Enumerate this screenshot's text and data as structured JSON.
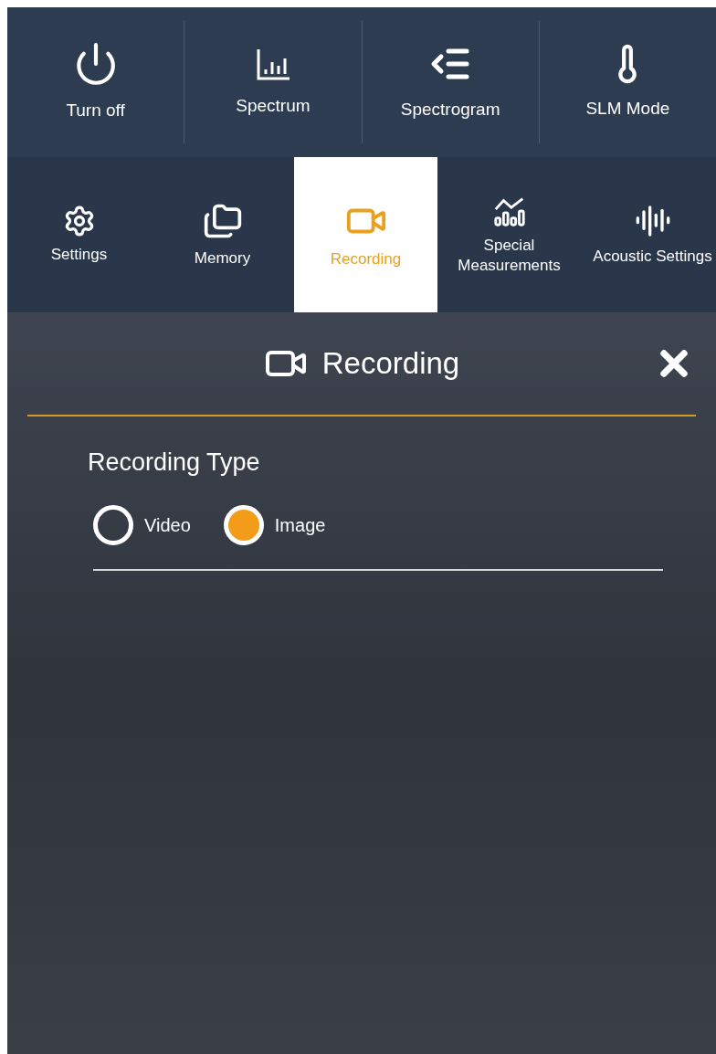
{
  "actions": [
    {
      "kind": "power",
      "label": "Turn off"
    },
    {
      "kind": "spectrum",
      "label": "Spectrum"
    },
    {
      "kind": "spectrogram",
      "label": "Spectrogram"
    },
    {
      "kind": "thermometer",
      "label": "SLM Mode"
    }
  ],
  "tabs": [
    {
      "kind": "gear",
      "label": "Settings",
      "selected": false
    },
    {
      "kind": "folders",
      "label": "Memory",
      "selected": false
    },
    {
      "kind": "video",
      "label": "Recording",
      "selected": true
    },
    {
      "kind": "trend",
      "label": "Special Measurements",
      "selected": false
    },
    {
      "kind": "wave",
      "label": "Acoustic Settings",
      "selected": false
    }
  ],
  "panel": {
    "title": "Recording",
    "section": "Recording Type",
    "options": [
      {
        "label": "Video",
        "selected": false
      },
      {
        "label": "Image",
        "selected": true
      }
    ]
  }
}
